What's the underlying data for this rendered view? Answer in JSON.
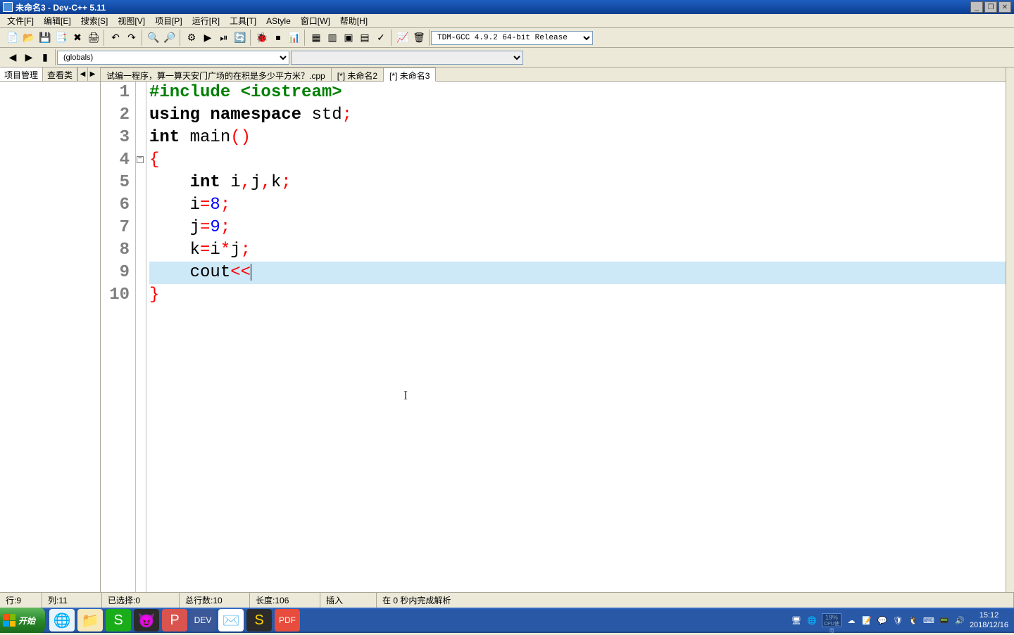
{
  "window": {
    "title": "未命名3 - Dev-C++ 5.11"
  },
  "menu": {
    "file": "文件[F]",
    "edit": "编辑[E]",
    "search": "搜索[S]",
    "view": "视图[V]",
    "project": "项目[P]",
    "run": "运行[R]",
    "tools": "工具[T]",
    "astyle": "AStyle",
    "window": "窗口[W]",
    "help": "帮助[H]"
  },
  "toolbar": {
    "compiler_selected": "TDM-GCC 4.9.2 64-bit Release"
  },
  "scope": {
    "globals": "(globals)"
  },
  "left_panel": {
    "tab_project": "项目管理",
    "tab_class": "查看类"
  },
  "tabs": [
    {
      "label": "试编一程序，算一算天安门广场的在积是多少平方米？.cpp",
      "active": false
    },
    {
      "label": "[*] 未命名2",
      "active": false
    },
    {
      "label": "[*] 未命名3",
      "active": true
    }
  ],
  "code": {
    "lines": [
      {
        "n": 1,
        "html": "<span class='pre'>#include &lt;iostream&gt;</span>"
      },
      {
        "n": 2,
        "html": "<span class='kw'>using</span> <span class='kw'>namespace</span> <span class='ident'>std</span><span class='punct'>;</span>"
      },
      {
        "n": 3,
        "html": "<span class='kw'>int</span> <span class='ident'>main</span><span class='punct'>()</span>"
      },
      {
        "n": 4,
        "html": "<span class='punct'>{</span>"
      },
      {
        "n": 5,
        "html": "    <span class='kw'>int</span> <span class='ident'>i</span><span class='punct'>,</span><span class='ident'>j</span><span class='punct'>,</span><span class='ident'>k</span><span class='punct'>;</span>"
      },
      {
        "n": 6,
        "html": "    <span class='ident'>i</span><span class='punct'>=</span><span class='num'>8</span><span class='punct'>;</span>"
      },
      {
        "n": 7,
        "html": "    <span class='ident'>j</span><span class='punct'>=</span><span class='num'>9</span><span class='punct'>;</span>"
      },
      {
        "n": 8,
        "html": "    <span class='ident'>k</span><span class='punct'>=</span><span class='ident'>i</span><span class='punct'>*</span><span class='ident'>j</span><span class='punct'>;</span>"
      },
      {
        "n": 9,
        "html": "    <span class='ident'>cout</span><span class='punct'>&lt;&lt;</span><span class='cursor'></span>",
        "hl": true
      },
      {
        "n": 10,
        "html": "<span class='punct'>}</span>"
      }
    ]
  },
  "status": {
    "row_label": "行: ",
    "row": "9",
    "col_label": "列: ",
    "col": "11",
    "sel_label": "已选择: ",
    "sel": "0",
    "lines_label": "总行数: ",
    "lines": "10",
    "len_label": "长度: ",
    "len": "106",
    "mode": "插入",
    "parse": "在 0 秒内完成解析"
  },
  "taskbar": {
    "start": "开始",
    "cpu_pct": "19%",
    "cpu_label": "CPU使用",
    "time": "15:12",
    "date": "2018/12/16"
  }
}
